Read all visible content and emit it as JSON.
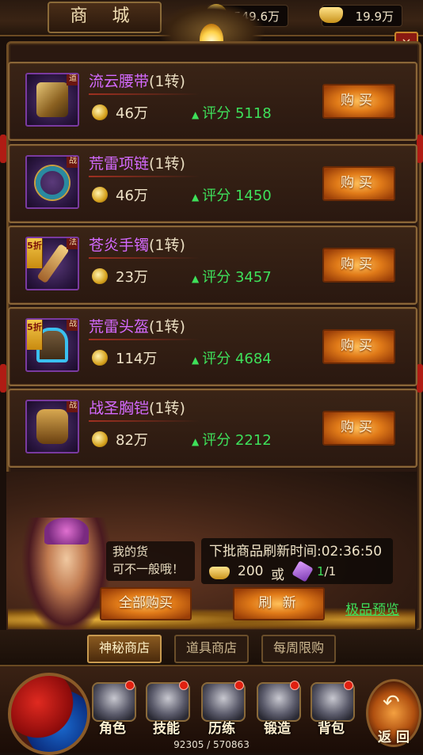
{
  "header": {
    "title": "商 城",
    "gold_amount": "1549.6万",
    "ingot_amount": "19.9万",
    "close_label": "×"
  },
  "items": [
    {
      "name": "流云腰带",
      "level": "(1转)",
      "class_tag": "道",
      "price": "46万",
      "score": "评分 5118",
      "buy_label": "购买",
      "discount": ""
    },
    {
      "name": "荒雷项链",
      "level": "(1转)",
      "class_tag": "战",
      "price": "46万",
      "score": "评分 1450",
      "buy_label": "购买",
      "discount": ""
    },
    {
      "name": "苍炎手镯",
      "level": "(1转)",
      "class_tag": "法",
      "price": "23万",
      "score": "评分 3457",
      "buy_label": "购买",
      "discount": "5折"
    },
    {
      "name": "荒雷头盔",
      "level": "(1转)",
      "class_tag": "战",
      "price": "114万",
      "score": "评分 4684",
      "buy_label": "购买",
      "discount": "5折"
    },
    {
      "name": "战圣胸铠",
      "level": "(1转)",
      "class_tag": "战",
      "price": "82万",
      "score": "评分 2212",
      "buy_label": "购买",
      "discount": ""
    }
  ],
  "npc": {
    "speech_line1": "我的货",
    "speech_line2": "可不一般哦！"
  },
  "refresh": {
    "time_label": "下批商品刷新时间:02:36:50",
    "ingot_cost": "200",
    "or_label": "或",
    "token_owned": "1",
    "token_need": "/1"
  },
  "actions": {
    "buy_all_label": "全部购买",
    "refresh_label": "刷 新",
    "preview_label": "极品预览"
  },
  "tabs": [
    {
      "label": "神秘商店",
      "active": true
    },
    {
      "label": "道具商店",
      "active": false
    },
    {
      "label": "每周限购",
      "active": false
    }
  ],
  "menu": [
    {
      "label": "角色",
      "icon": "character-icon"
    },
    {
      "label": "技能",
      "icon": "skill-icon"
    },
    {
      "label": "历练",
      "icon": "training-icon"
    },
    {
      "label": "锻造",
      "icon": "forge-icon"
    },
    {
      "label": "背包",
      "icon": "bag-icon"
    }
  ],
  "back_label": "返 回",
  "exp_text": "92305 / 570863",
  "colors": {
    "item_name": "#d46aff",
    "score_green": "#3ee05a",
    "button_orange": "#e07a18"
  }
}
